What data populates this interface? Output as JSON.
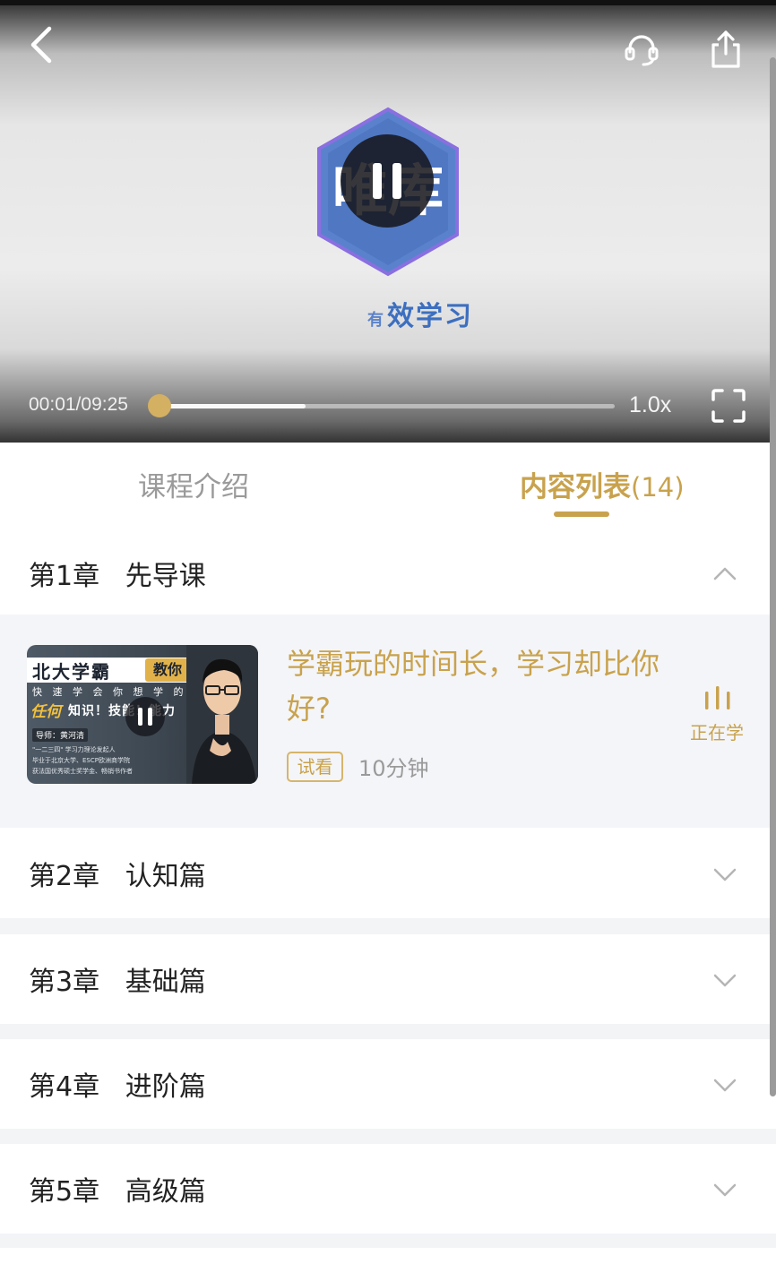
{
  "player": {
    "time": "00:01/09:25",
    "progress": 0.0,
    "buffered": 0.32,
    "speed": "1.0x",
    "logo_text": "唯库",
    "slogan_small": "有",
    "slogan": "效学习"
  },
  "tabs": [
    {
      "label": "课程介绍",
      "active": false
    },
    {
      "label": "内容列表",
      "count": "(14)",
      "active": true
    }
  ],
  "chapters": [
    {
      "title": "第1章   先导课",
      "expanded": true
    },
    {
      "title": "第2章   认知篇",
      "expanded": false
    },
    {
      "title": "第3章   基础篇",
      "expanded": false
    },
    {
      "title": "第4章   进阶篇",
      "expanded": false
    },
    {
      "title": "第5章   高级篇",
      "expanded": false
    }
  ],
  "lesson": {
    "title": "学霸玩的时间长，学习却比你好?",
    "badge": "试看",
    "duration": "10分钟",
    "status": "正在学",
    "thumb": {
      "head": "北大学霸",
      "badge": "教你",
      "line1": "快 速 学 会 你 想 学 的",
      "any": "任何",
      "line2": "知识！技能！能力",
      "tag": "导师：黄河清",
      "small1": "\"一二三四\" 学习力理论发起人",
      "small2": "毕业于北京大学、ESCP欧洲商学院",
      "small3": "获法国优秀硕士奖学金、畅销书作者"
    }
  },
  "colors": {
    "accent": "#c8a24d",
    "knob": "#d4b062",
    "muted": "#9a9a9a"
  }
}
